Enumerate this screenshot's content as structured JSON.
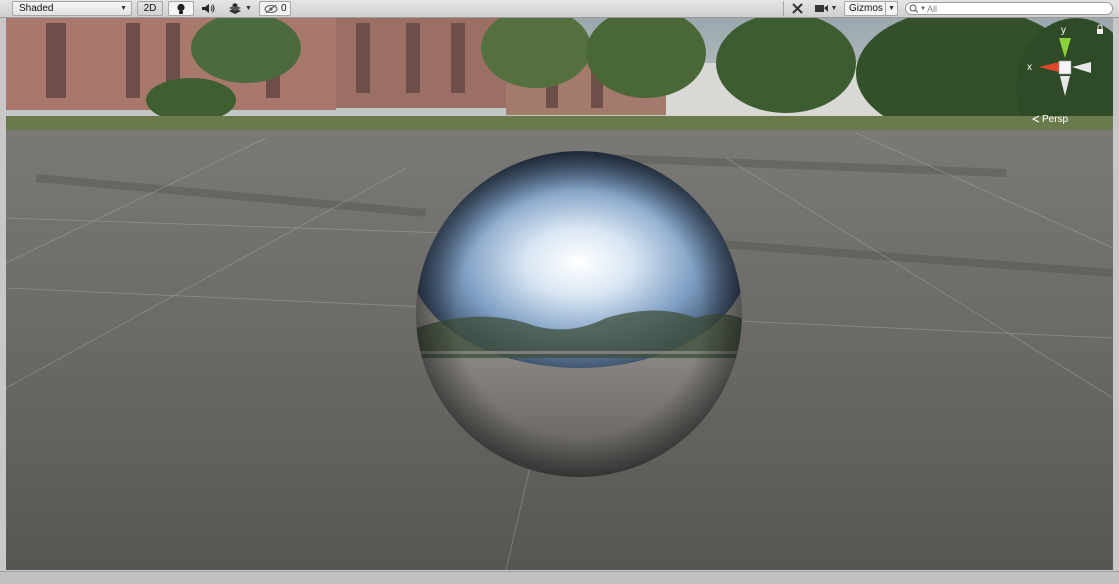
{
  "toolbar": {
    "shading_mode": "Shaded",
    "mode_2d": "2D",
    "hidden_count": "0",
    "gizmos_label": "Gizmos",
    "search_placeholder": "All"
  },
  "gizmo": {
    "axis_x": "x",
    "axis_y": "y",
    "projection": "Persp"
  }
}
